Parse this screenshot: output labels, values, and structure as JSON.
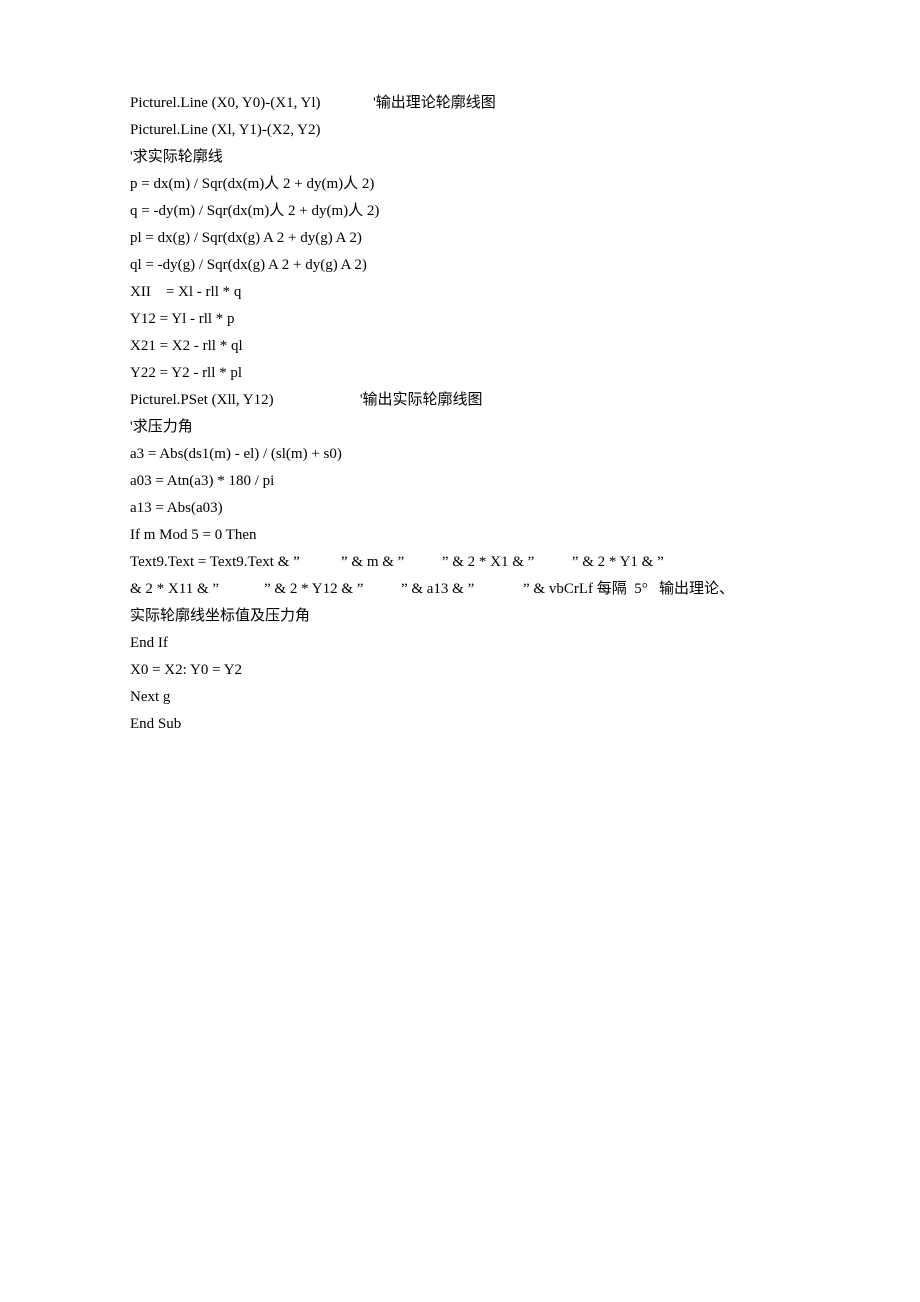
{
  "lines": [
    "Picturel.Line (X0, Y0)-(X1, Yl)              '输出理论轮廓线图",
    "Picturel.Line (Xl, Y1)-(X2, Y2)",
    "'求实际轮廓线",
    "p = dx(m) / Sqr(dx(m)人 2 + dy(m)人 2)",
    "q = -dy(m) / Sqr(dx(m)人 2 + dy(m)人 2)",
    "pl = dx(g) / Sqr(dx(g) A 2 + dy(g) A 2)",
    "ql = -dy(g) / Sqr(dx(g) A 2 + dy(g) A 2)",
    "XII    = Xl - rll * q",
    "Y12 = Yl - rll * p",
    "X21 = X2 - rll * ql",
    "Y22 = Y2 - rll * pl",
    "Picturel.PSet (Xll, Y12)                       '输出实际轮廓线图",
    "'求压力角",
    "a3 = Abs(ds1(m) - el) / (sl(m) + s0)",
    "a03 = Atn(a3) * 180 / pi",
    "a13 = Abs(a03)",
    "If m Mod 5 = 0 Then",
    "Text9.Text = Text9.Text & ”           ” & m & ”          ” & 2 * X1 & ”          ” & 2 * Y1 & ”",
    "& 2 * X11 & ”            ” & 2 * Y12 & ”          ” & a13 & ”             ” & vbCrLf 每隔  5°   输出理论、",
    "实际轮廓线坐标值及压力角",
    "End If",
    "X0 = X2: Y0 = Y2",
    "Next g",
    "End Sub"
  ]
}
